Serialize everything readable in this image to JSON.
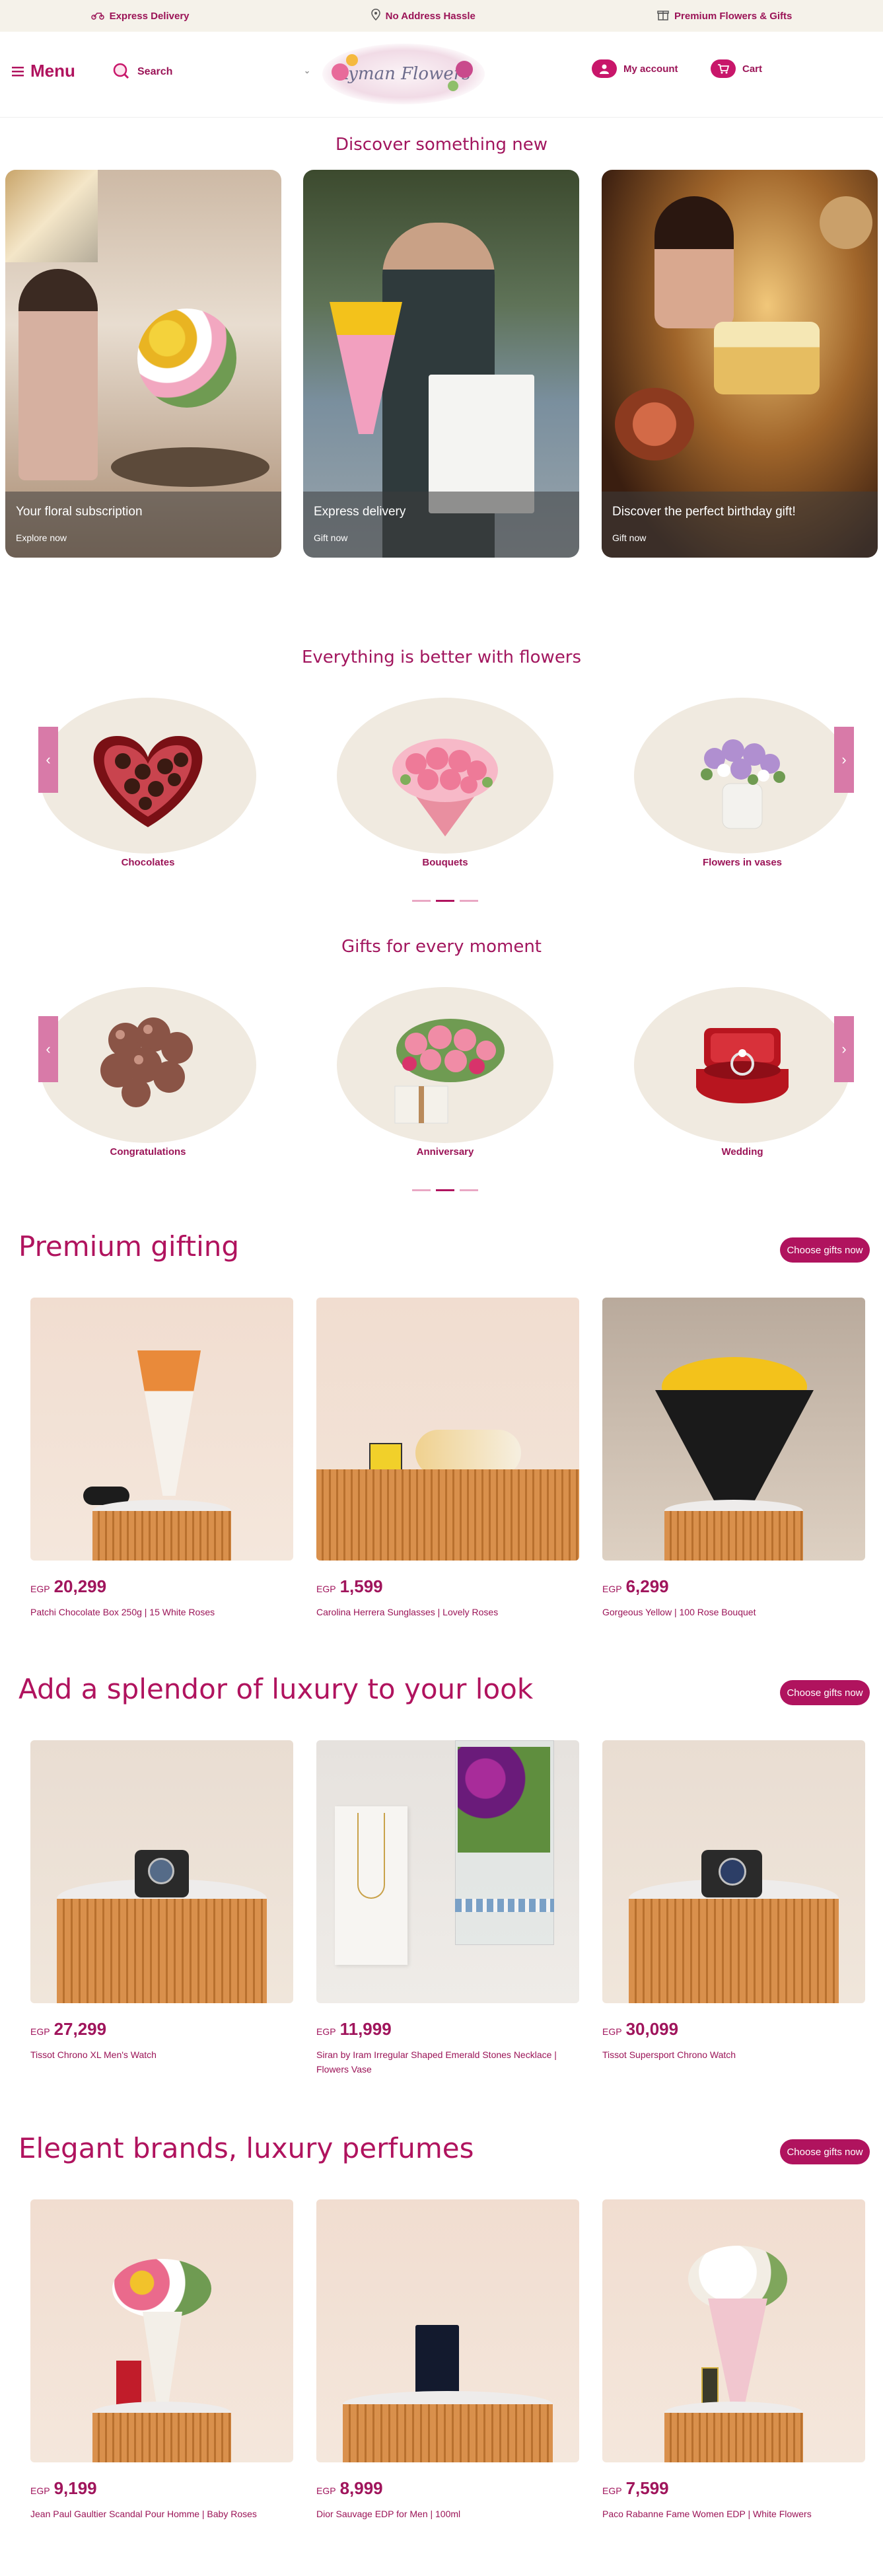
{
  "topbar": {
    "express": "Express Delivery",
    "no_address": "No Address Hassle",
    "premium": "Premium Flowers & Gifts"
  },
  "header": {
    "menu": "Menu",
    "search": "Search",
    "logo_text": "Ayman Flowers",
    "account": "My account",
    "cart": "Cart"
  },
  "discover": {
    "title": "Discover something new",
    "cards": [
      {
        "title": "Your floral subscription",
        "cta": "Explore now"
      },
      {
        "title": "Express delivery",
        "cta": "Gift now"
      },
      {
        "title": "Discover the perfect birthday gift!",
        "cta": "Gift now"
      }
    ]
  },
  "everything": {
    "title": "Everything is better with flowers",
    "items": [
      "Chocolates",
      "Bouquets",
      "Flowers in vases"
    ]
  },
  "gifts": {
    "title": "Gifts for every moment",
    "items": [
      "Congratulations",
      "Anniversary",
      "Wedding"
    ]
  },
  "premium": {
    "title": "Premium gifting",
    "cta": "Choose gifts now",
    "products": [
      {
        "currency": "EGP",
        "price": "20,299",
        "name": "Patchi Chocolate Box 250g | 15 White Roses"
      },
      {
        "currency": "EGP",
        "price": "1,599",
        "name": "Carolina Herrera Sunglasses | Lovely Roses"
      },
      {
        "currency": "EGP",
        "price": "6,299",
        "name": "Gorgeous Yellow | 100 Rose Bouquet"
      }
    ]
  },
  "luxury": {
    "title": "Add a splendor of luxury to your look",
    "cta": "Choose gifts now",
    "products": [
      {
        "currency": "EGP",
        "price": "27,299",
        "name": "Tissot Chrono XL Men's Watch"
      },
      {
        "currency": "EGP",
        "price": "11,999",
        "name": "Siran by Iram Irregular Shaped Emerald Stones Necklace | Flowers Vase"
      },
      {
        "currency": "EGP",
        "price": "30,099",
        "name": "Tissot Supersport Chrono Watch"
      }
    ]
  },
  "perfumes": {
    "title": "Elegant brands, luxury perfumes",
    "cta": "Choose gifts now",
    "products": [
      {
        "currency": "EGP",
        "price": "9,199",
        "name": "Jean Paul Gaultier Scandal Pour Homme | Baby Roses"
      },
      {
        "currency": "EGP",
        "price": "8,999",
        "name": "Dior Sauvage EDP for Men | 100ml"
      },
      {
        "currency": "EGP",
        "price": "7,599",
        "name": "Paco Rabanne Fame Women EDP | White Flowers"
      }
    ]
  },
  "colors": {
    "brand": "#b0135e",
    "cream": "#f0eae0",
    "arrow": "#d87aa8"
  }
}
